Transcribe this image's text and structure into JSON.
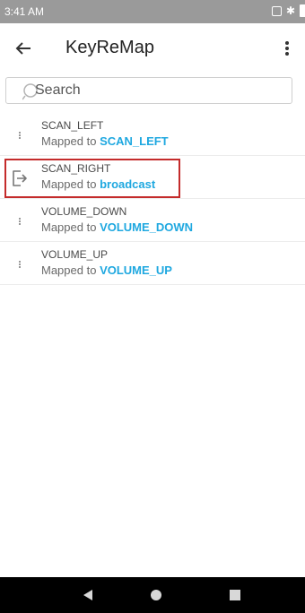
{
  "status_bar": {
    "time": "3:41 AM",
    "icons": [
      "screenshot-icon",
      "bluetooth-icon",
      "battery-icon"
    ]
  },
  "app_bar": {
    "title": "KeyReMap",
    "back_icon": "arrow-left-icon",
    "menu_icon": "more-vert-icon"
  },
  "search": {
    "placeholder": "Search"
  },
  "mapped_prefix": "Mapped to",
  "items": [
    {
      "name": "SCAN_LEFT",
      "mapped_to": "SCAN_LEFT",
      "icon": "drag-handle-icon",
      "highlighted": false
    },
    {
      "name": "SCAN_RIGHT",
      "mapped_to": "broadcast",
      "icon": "exit-to-app-icon",
      "highlighted": true
    },
    {
      "name": "VOLUME_DOWN",
      "mapped_to": "VOLUME_DOWN",
      "icon": "drag-handle-icon",
      "highlighted": false
    },
    {
      "name": "VOLUME_UP",
      "mapped_to": "VOLUME_UP",
      "icon": "drag-handle-icon",
      "highlighted": false
    }
  ],
  "colors": {
    "accent": "#1fa8e0",
    "highlight_border": "#c42b2b",
    "status_bar": "#9a9a9a",
    "nav_bar": "#000000"
  },
  "nav": {
    "buttons": [
      "back",
      "home",
      "recents"
    ]
  }
}
